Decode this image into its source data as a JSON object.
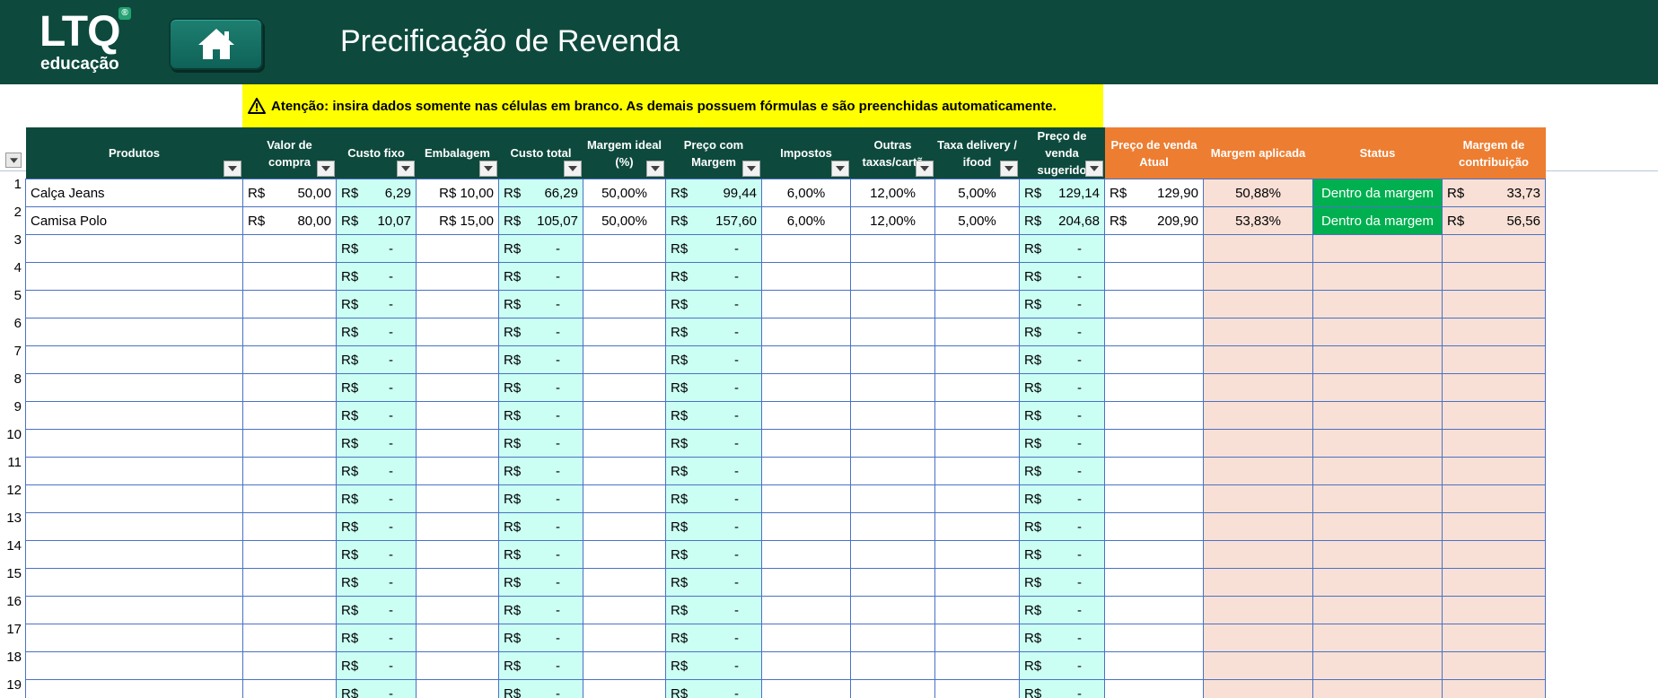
{
  "brand": {
    "logo_text": "LTQ",
    "logo_sub": "educação",
    "logo_mark": "®"
  },
  "page": {
    "title": "Precificação de Revenda"
  },
  "warning": {
    "text": "Atenção: insira dados somente nas células em branco. As demais possuem fórmulas e são preenchidas automaticamente."
  },
  "colors": {
    "header_green": "#0d4a3d",
    "header_orange": "#ed7d31",
    "calc_cyan": "#ccfff4",
    "calc_peach": "#f8e0d6",
    "status_green": "#00b050",
    "warning_yellow": "#ffff00",
    "grid_blue": "#4a72c4"
  },
  "table": {
    "columns": [
      {
        "key": "produto",
        "label": "Produtos",
        "style": "g",
        "filter": true
      },
      {
        "key": "valor_compra",
        "label": "Valor de compra",
        "style": "g",
        "filter": true
      },
      {
        "key": "custo_fixo",
        "label": "Custo fixo",
        "style": "g",
        "filter": true
      },
      {
        "key": "embalagem",
        "label": "Embalagem",
        "style": "g",
        "filter": true
      },
      {
        "key": "custo_total",
        "label": "Custo total",
        "style": "g",
        "filter": true
      },
      {
        "key": "margem_ideal",
        "label": "Margem ideal (%)",
        "style": "g",
        "filter": true
      },
      {
        "key": "preco_margem",
        "label": "Preço com Margem",
        "style": "g",
        "filter": true
      },
      {
        "key": "impostos",
        "label": "Impostos",
        "style": "g",
        "filter": true
      },
      {
        "key": "outras_taxas",
        "label": "Outras taxas/cartã",
        "style": "g",
        "filter": true
      },
      {
        "key": "taxa_delivery",
        "label": "Taxa delivery / ifood",
        "style": "g",
        "filter": true
      },
      {
        "key": "preco_sugerido",
        "label": "Preço de venda sugerido",
        "style": "g",
        "filter": true
      },
      {
        "key": "preco_atual",
        "label": "Preço de venda Atual",
        "style": "o",
        "filter": false
      },
      {
        "key": "margem_aplicada",
        "label": "Margem aplicada",
        "style": "o",
        "filter": false
      },
      {
        "key": "status",
        "label": "Status",
        "style": "o",
        "filter": false
      },
      {
        "key": "margem_contribuicao",
        "label": "Margem de contribuição",
        "style": "o",
        "filter": false
      }
    ],
    "currency": "R$",
    "empty_value": "-",
    "rows": [
      {
        "n": "1",
        "produto": "Calça Jeans",
        "valor_compra": "50,00",
        "custo_fixo": "6,29",
        "embalagem": "R$ 10,00",
        "custo_total": "66,29",
        "margem_ideal": "50,00%",
        "preco_margem": "99,44",
        "impostos": "6,00%",
        "outras_taxas": "12,00%",
        "taxa_delivery": "5,00%",
        "preco_sugerido": "129,14",
        "preco_atual": "129,90",
        "margem_aplicada": "50,88%",
        "status": "Dentro da margem",
        "margem_contribuicao": "33,73"
      },
      {
        "n": "2",
        "produto": "Camisa Polo",
        "valor_compra": "80,00",
        "custo_fixo": "10,07",
        "embalagem": "R$ 15,00",
        "custo_total": "105,07",
        "margem_ideal": "50,00%",
        "preco_margem": "157,60",
        "impostos": "6,00%",
        "outras_taxas": "12,00%",
        "taxa_delivery": "5,00%",
        "preco_sugerido": "204,68",
        "preco_atual": "209,90",
        "margem_aplicada": "53,83%",
        "status": "Dentro da margem",
        "margem_contribuicao": "56,56"
      }
    ],
    "empty_row_numbers": [
      "3",
      "4",
      "5",
      "6",
      "7",
      "8",
      "9",
      "10",
      "11",
      "12",
      "13",
      "14",
      "15",
      "16",
      "17",
      "18",
      "19"
    ]
  }
}
